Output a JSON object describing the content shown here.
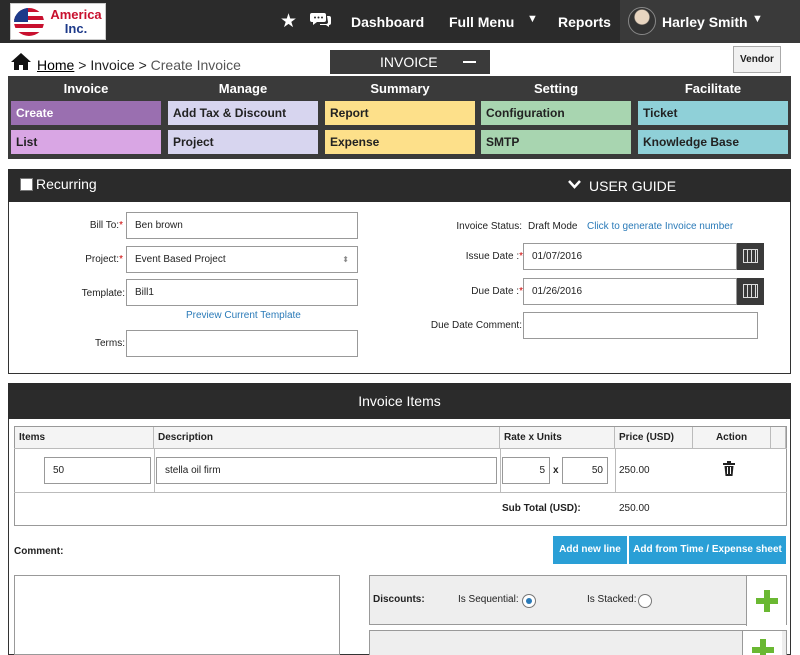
{
  "logo": {
    "line1": "America",
    "line2": "Inc."
  },
  "topnav": {
    "dashboard": "Dashboard",
    "full_menu": "Full Menu",
    "reports": "Reports",
    "user_name": "Harley Smith"
  },
  "breadcrumb": {
    "home": "Home",
    "sep1": " > ",
    "invoice": "Invoice",
    "sep2": " > ",
    "current": "Create Invoice"
  },
  "invoice_tab": "INVOICE",
  "vendor_button": "Vendor",
  "menu": {
    "headers": [
      "Invoice",
      "Manage",
      "Summary",
      "Setting",
      "Facilitate"
    ],
    "row1": [
      "Create",
      "Add Tax & Discount",
      "Report",
      "Configuration",
      "Ticket"
    ],
    "row2": [
      "List",
      "Project",
      "Expense",
      "SMTP",
      "Knowledge Base"
    ],
    "colors": [
      "#9a6fb0",
      "#d7d5ef",
      "#fde08a",
      "#a8d5b0",
      "#8fd0d8"
    ],
    "row2_first_color": "#d9a6e4"
  },
  "recurring": {
    "label": "Recurring",
    "user_guide": "USER GUIDE"
  },
  "form": {
    "bill_to_label": "Bill To:",
    "bill_to_value": "Ben brown",
    "project_label": "Project:",
    "project_value": "Event Based Project",
    "template_label": "Template:",
    "template_value": "Bill1",
    "preview_link": "Preview Current Template",
    "terms_label": "Terms:",
    "terms_value": "",
    "status_label": "Invoice Status:",
    "status_value": "Draft Mode",
    "generate_link": "Click to generate Invoice number",
    "issue_label": "Issue Date :",
    "issue_value": "01/07/2016",
    "due_label": "Due Date :",
    "due_value": "01/26/2016",
    "due_comment_label": "Due Date Comment:",
    "due_comment_value": ""
  },
  "items": {
    "title": "Invoice Items",
    "columns": [
      "Items",
      "Description",
      "Rate x Units",
      "Price (USD)",
      "Action"
    ],
    "row": {
      "item": "50",
      "description": "stella oil firm",
      "rate": "5",
      "x": "x",
      "units": "50",
      "price": "250.00"
    },
    "subtotal_label": "Sub Total (USD):",
    "subtotal_value": "250.00",
    "comment_label": "Comment:",
    "add_line": "Add new line",
    "add_from": "Add from Time / Expense sheet",
    "discounts_label": "Discounts:",
    "is_sequential": "Is Sequential:",
    "is_stacked": "Is Stacked:"
  }
}
